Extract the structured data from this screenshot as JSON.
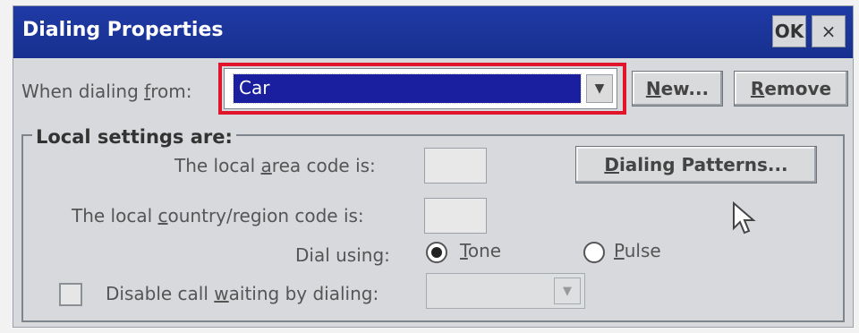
{
  "window": {
    "title": "Dialing Properties",
    "ok_label": "OK",
    "close_label": "×"
  },
  "dialing_from": {
    "label_pre": "When dialing ",
    "label_u": "f",
    "label_post": "rom:",
    "selected": "Car",
    "new_pre": "",
    "new_u": "N",
    "new_post": "ew...",
    "remove_pre": "",
    "remove_u": "R",
    "remove_post": "emove"
  },
  "local": {
    "group_title": "Local settings are:",
    "area_pre": "The local ",
    "area_u": "a",
    "area_post": "rea code is:",
    "area_value": "",
    "country_pre": "The local ",
    "country_u": "c",
    "country_post": "ountry/region code is:",
    "country_value": "",
    "patterns_pre": "",
    "patterns_u": "D",
    "patterns_post": "ialing Patterns...",
    "dial_using_label": "Dial using:",
    "tone_u": "T",
    "tone_post": "one",
    "pulse_u": "P",
    "pulse_post": "ulse",
    "selected_dial": "Tone",
    "cw_pre": "Disable call ",
    "cw_u": "w",
    "cw_post": "aiting by dialing:",
    "cw_checked": false
  },
  "icons": {
    "dropdown": "chevron-down-icon",
    "cursor": "mouse-pointer-icon"
  },
  "colors": {
    "titlebar": "#1f3aa5",
    "selection": "#1a1fa0",
    "highlight": "#e0142b"
  }
}
